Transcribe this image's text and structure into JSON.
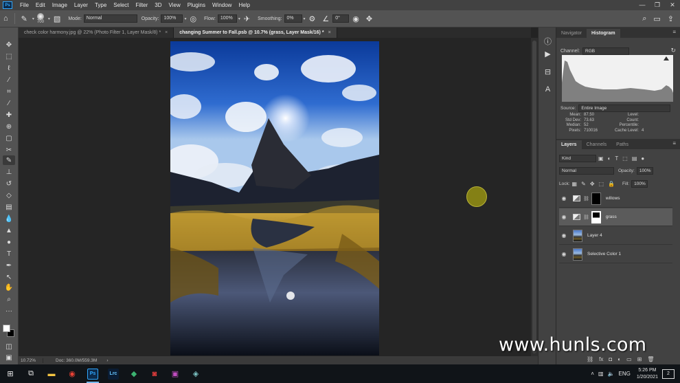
{
  "menubar": {
    "logo": "Ps",
    "items": [
      "File",
      "Edit",
      "Image",
      "Layer",
      "Type",
      "Select",
      "Filter",
      "3D",
      "View",
      "Plugins",
      "Window",
      "Help"
    ],
    "controls": [
      "—",
      "❐",
      "✕"
    ]
  },
  "options": {
    "brush_size": "700",
    "mode_label": "Mode:",
    "mode_value": "Normal",
    "opacity_label": "Opacity:",
    "opacity_value": "100%",
    "flow_label": "Flow:",
    "flow_value": "100%",
    "smoothing_label": "Smoothing:",
    "smoothing_value": "0%",
    "angle_value": "0°"
  },
  "tabs": [
    {
      "label": "check color harmony.jpg @ 22% (Photo Filter 1, Layer Mask/8) *",
      "active": false
    },
    {
      "label": "changing Summer to Fall.psb @ 10.7% (grass, Layer Mask/16) *",
      "active": true
    }
  ],
  "status": {
    "zoom": "10.72%",
    "doc": "Doc: 360.0M/559.3M",
    "arrow": "›"
  },
  "histogram": {
    "tabs": [
      "Navigator",
      "Histogram"
    ],
    "active_tab": "Histogram",
    "channel_label": "Channel:",
    "channel_value": "RGB",
    "source_label": "Source:",
    "source_value": "Entire Image",
    "stats_left": [
      {
        "k": "Mean:",
        "v": "87.50"
      },
      {
        "k": "Std Dev:",
        "v": "73.63"
      },
      {
        "k": "Median:",
        "v": "52"
      },
      {
        "k": "Pixels:",
        "v": "710016"
      }
    ],
    "stats_right": [
      {
        "k": "Level:",
        "v": ""
      },
      {
        "k": "Count:",
        "v": ""
      },
      {
        "k": "Percentile:",
        "v": ""
      },
      {
        "k": "Cache Level:",
        "v": "4"
      }
    ]
  },
  "layers": {
    "tabs": [
      "Layers",
      "Channels",
      "Paths"
    ],
    "active_tab": "Layers",
    "filter_value": "Kind",
    "blend_value": "Normal",
    "opacity_label": "Opacity:",
    "opacity_value": "100%",
    "lock_label": "Lock:",
    "fill_label": "Fill:",
    "fill_value": "100%",
    "items": [
      {
        "name": "willows",
        "kind": "adjustment-black-mask"
      },
      {
        "name": "grass",
        "kind": "adjustment-grass-mask",
        "selected": true
      },
      {
        "name": "Layer 4",
        "kind": "image"
      },
      {
        "name": "Selective Color 1",
        "kind": "image"
      }
    ]
  },
  "watermark": "www.hunls.com",
  "taskbar": {
    "apps": [
      {
        "label": "Ps",
        "color": "#31a8ff",
        "bg": "#0c2a4a",
        "active": true
      },
      {
        "label": "Lrc",
        "color": "#67c6ff",
        "bg": "#0a1c33",
        "active": false
      }
    ],
    "lang": "ENG",
    "time": "5:26 PM",
    "date": "1/20/2021",
    "notifications": "2"
  }
}
